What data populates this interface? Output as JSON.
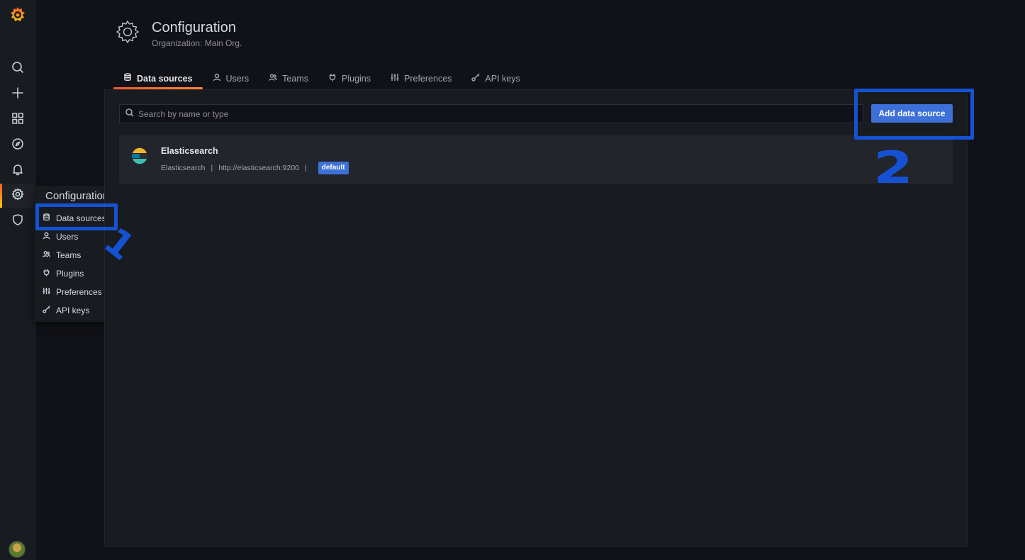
{
  "sidebar": {
    "items": [
      {
        "icon": "search-icon"
      },
      {
        "icon": "plus-icon"
      },
      {
        "icon": "dashboards-icon"
      },
      {
        "icon": "explore-compass-icon"
      },
      {
        "icon": "bell-icon"
      },
      {
        "icon": "gear-icon"
      },
      {
        "icon": "shield-icon"
      }
    ]
  },
  "flyout": {
    "title": "Configuration",
    "items": [
      {
        "label": "Data sources",
        "icon": "database-icon"
      },
      {
        "label": "Users",
        "icon": "user-icon"
      },
      {
        "label": "Teams",
        "icon": "users-icon"
      },
      {
        "label": "Plugins",
        "icon": "plug-icon"
      },
      {
        "label": "Preferences",
        "icon": "sliders-icon"
      },
      {
        "label": "API keys",
        "icon": "key-icon"
      }
    ]
  },
  "header": {
    "title": "Configuration",
    "subtitle": "Organization: Main Org."
  },
  "tabs": [
    {
      "label": "Data sources",
      "active": true
    },
    {
      "label": "Users"
    },
    {
      "label": "Teams"
    },
    {
      "label": "Plugins"
    },
    {
      "label": "Preferences"
    },
    {
      "label": "API keys"
    }
  ],
  "search": {
    "placeholder": "Search by name or type",
    "value": ""
  },
  "add_button": {
    "label": "Add data source"
  },
  "datasources": [
    {
      "name": "Elasticsearch",
      "type": "Elasticsearch",
      "url": "http://elasticsearch:9200",
      "badge": "default",
      "sep": "|"
    }
  ],
  "annotations": {
    "one": "1",
    "two": "2"
  },
  "colors": {
    "accent": "#3d71d9",
    "annotation": "#1552d3",
    "active_tab": "#f05a28"
  }
}
